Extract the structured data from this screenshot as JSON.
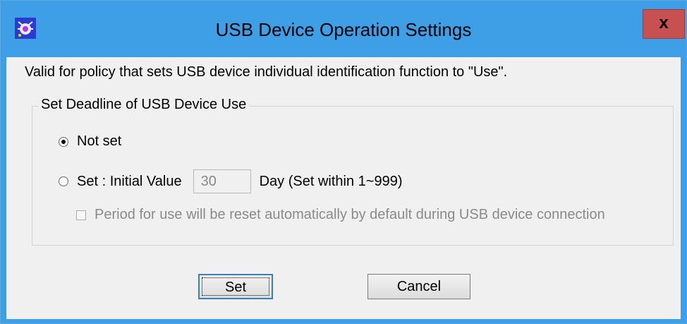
{
  "window": {
    "title": "USB Device Operation Settings",
    "close_label": "x",
    "app_icon": "usb-app-icon"
  },
  "description": "Valid for policy that sets USB device individual identification function to \"Use\".",
  "deadline_group": {
    "title": "Set Deadline of USB Device Use",
    "option_not_set": "Not set",
    "option_set": "Set : Initial Value",
    "selected": "Not set",
    "initial_value": "30",
    "day_label": "Day (Set within 1~999)",
    "reset_checkbox_label": "Period for use will be reset automatically by default during USB device connection",
    "reset_checked": false
  },
  "buttons": {
    "set": "Set",
    "cancel": "Cancel"
  },
  "colors": {
    "titlebar": "#3f9fe6",
    "close": "#c75050",
    "client": "#f0f0f0"
  }
}
